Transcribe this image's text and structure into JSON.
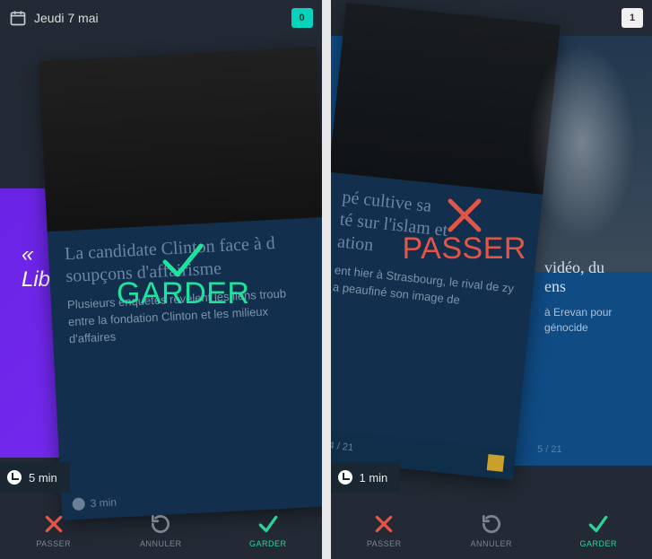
{
  "left": {
    "topbar": {
      "date": "Jeudi 7 mai",
      "badge": "0"
    },
    "behind": {
      "quote_fragment": "«\nLib"
    },
    "card": {
      "title": "La candidate Clinton face à d\nsoupçons d'affairisme",
      "desc": "Plusieurs enquêtes révèlent les liens troub entre la fondation Clinton et les milieux d'affaires",
      "time": "3 min",
      "index": ""
    },
    "stamp": {
      "label": "GARDER"
    },
    "timechip": {
      "time": "5 min"
    },
    "toolbar": {
      "pass": "PASSER",
      "undo": "ANNULER",
      "keep": "GARDER"
    }
  },
  "right": {
    "topbar": {
      "date": "",
      "badge": "1"
    },
    "behind": {
      "title": "vidéo, du\nens",
      "desc": "à Erevan pour génocide",
      "pager": "5 / 21"
    },
    "card": {
      "title": "pé cultive sa\nté sur l'islam et\nation",
      "desc": "ent hier à Strasbourg, le rival de zy a peaufiné son image de",
      "time": "",
      "index": "4 / 21"
    },
    "stamp": {
      "label": "PASSER"
    },
    "timechip": {
      "time": "1 min"
    },
    "toolbar": {
      "pass": "PASSER",
      "undo": "ANNULER",
      "keep": "GARDER"
    }
  }
}
